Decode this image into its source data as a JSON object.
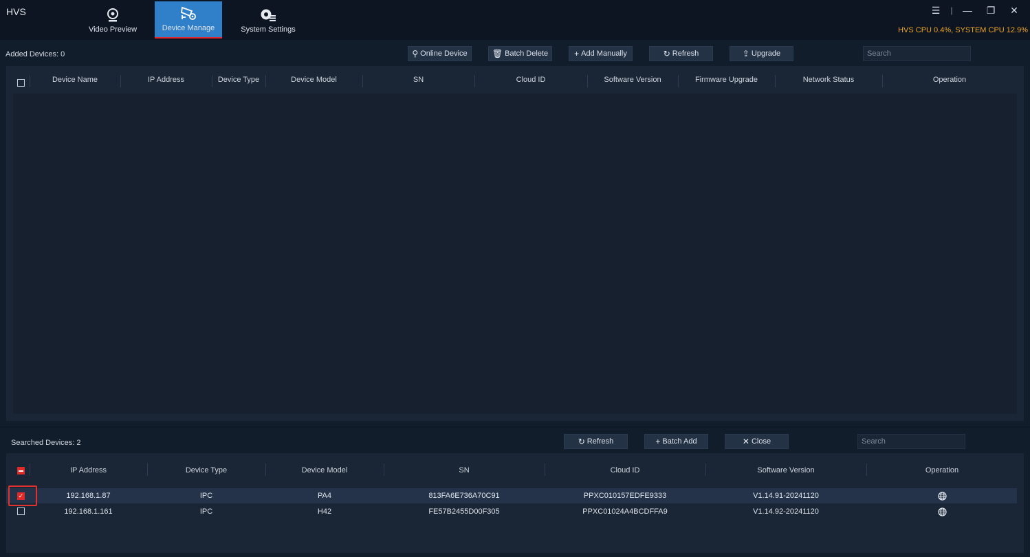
{
  "app": {
    "title": "HVS",
    "cpu": "HVS CPU 0.4%, SYSTEM CPU 12.9%"
  },
  "nav": {
    "tabs": [
      {
        "label": "Video Preview",
        "icon": "webcam-icon",
        "active": false
      },
      {
        "label": "Device Manage",
        "icon": "camera-settings-icon",
        "active": true
      },
      {
        "label": "System Settings",
        "icon": "gear-list-icon",
        "active": false
      }
    ]
  },
  "added": {
    "count_label": "Added Devices: 0",
    "buttons": {
      "online": "Online Device",
      "batch_delete": "Batch Delete",
      "add_manually": "Add Manually",
      "refresh": "Refresh",
      "upgrade": "Upgrade"
    },
    "search_placeholder": "Search",
    "columns": [
      "Device Name",
      "IP Address",
      "Device Type",
      "Device Model",
      "SN",
      "Cloud ID",
      "Software Version",
      "Firmware Upgrade",
      "Network Status",
      "Operation"
    ]
  },
  "searched": {
    "count_label": "Searched Devices: 2",
    "buttons": {
      "refresh": "Refresh",
      "batch_add": "Batch Add",
      "close": "Close"
    },
    "search_placeholder": "Search",
    "columns": [
      "IP Address",
      "Device Type",
      "Device Model",
      "SN",
      "Cloud ID",
      "Software Version",
      "Operation"
    ],
    "rows": [
      {
        "ip": "192.168.1.87",
        "type": "IPC",
        "model": "PA4",
        "sn": "813FA6E736A70C91",
        "cloud": "PPXC010157EDFE9333",
        "version": "V1.14.91-20241120",
        "checked": true
      },
      {
        "ip": "192.168.1.161",
        "type": "IPC",
        "model": "H42",
        "sn": "FE57B2455D00F305",
        "cloud": "PPXC01024A4BCDFFA9",
        "version": "V1.14.92-20241120",
        "checked": false
      }
    ]
  },
  "colors": {
    "accent": "#2f80c9",
    "active_underline": "#e4262b",
    "cpu_text": "#f0a620",
    "checkbox_checked": "#e02a2a"
  }
}
